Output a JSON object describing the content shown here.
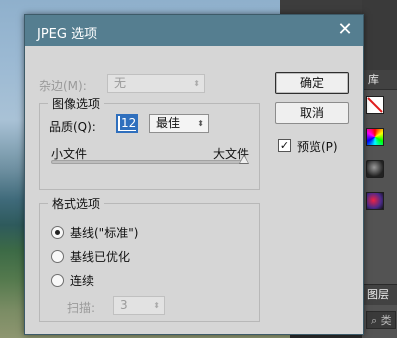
{
  "dialog": {
    "title": "JPEG 选项",
    "close_glyph": "✕"
  },
  "matte": {
    "label": "杂边(M):",
    "value": "无"
  },
  "image_options": {
    "legend": "图像选项",
    "quality_label": "品质(Q):",
    "quality_value": "12",
    "quality_preset": "最佳",
    "slider_min_label": "小文件",
    "slider_max_label": "大文件",
    "slider_fraction": 1.0
  },
  "format_options": {
    "legend": "格式选项",
    "radios": [
      {
        "label": "基线(\"标准\")",
        "selected": true
      },
      {
        "label": "基线已优化",
        "selected": false
      },
      {
        "label": "连续",
        "selected": false
      }
    ],
    "scans_label": "扫描:",
    "scans_value": "3"
  },
  "buttons": {
    "ok": "确定",
    "cancel": "取消"
  },
  "preview": {
    "label": "预览(P)",
    "checked": true,
    "check_glyph": "✓"
  },
  "background_panels": {
    "library_tab": "库",
    "layers_tab": "图层",
    "search_glyph": "⌕",
    "search_text": "类"
  },
  "colors": {
    "titlebar": "#557e90",
    "dialog_bg": "#d6d6d6",
    "focus_blue": "#2f6fbd"
  }
}
